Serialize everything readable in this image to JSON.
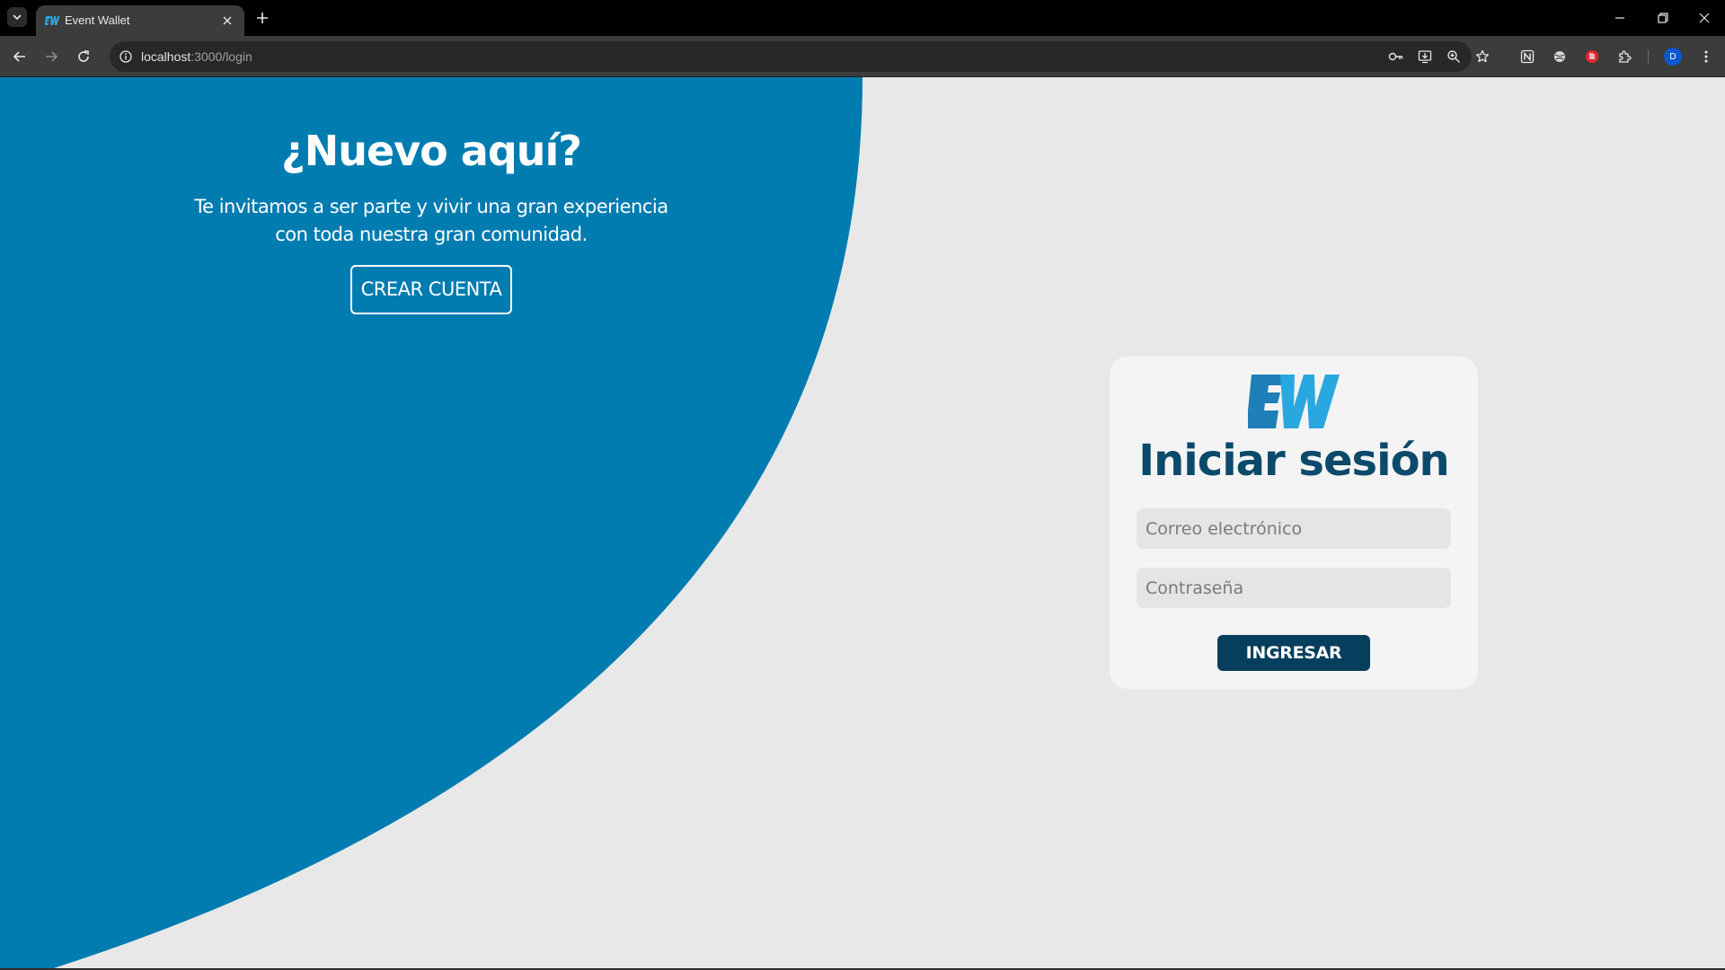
{
  "browser": {
    "tab_title": "Event Wallet",
    "url_host": "localhost",
    "url_path": ":3000/login",
    "avatar_initial": "D",
    "icons": [
      "tab-search-icon",
      "close-icon",
      "new-tab-icon",
      "minimize-icon",
      "restore-icon",
      "window-close-icon",
      "back-icon",
      "forward-icon",
      "reload-icon",
      "site-info-icon",
      "password-key-icon",
      "install-app-icon",
      "zoom-icon",
      "bookmark-star-icon",
      "extension-n-icon",
      "extension-globe-icon",
      "extension-red-icon",
      "extensions-puzzle-icon",
      "more-menu-icon"
    ]
  },
  "promo": {
    "title": "¿Nuevo aquí?",
    "text": "Te invitamos a ser parte y vivir una gran experiencia con toda nuestra gran comunidad.",
    "button_label": "CREAR CUENTA"
  },
  "login": {
    "logo": "EW",
    "title": "Iniciar sesión",
    "email_placeholder": "Correo electrónico",
    "password_placeholder": "Contraseña",
    "submit_label": "INGRESAR"
  },
  "colors": {
    "brand_blue": "#007cb1",
    "dark_navy": "#063e5e",
    "title_navy": "#0b4a6b",
    "logo_light": "#29a8e0",
    "background": "#e8e8e8",
    "card": "#f4f4f4"
  }
}
